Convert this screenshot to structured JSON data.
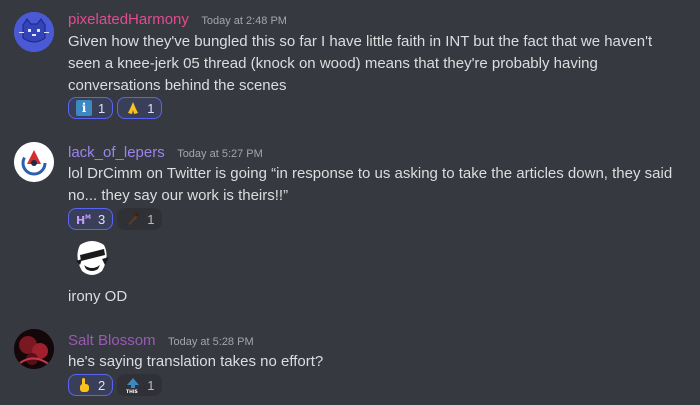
{
  "messages": [
    {
      "username": "pixelatedHarmony",
      "username_color": "#e14d8f",
      "timestamp": "Today at 2:48 PM",
      "text": "Given how they've bungled this so far I have little faith in INT but the fact that we haven't seen a knee-jerk 05 thread (knock on wood) means that they're probably having conversations behind the scenes",
      "reactions": [
        {
          "emoji": "information-emoji",
          "glyph": "i",
          "count": "1",
          "me": true
        },
        {
          "emoji": "folded-hands-emoji",
          "glyph": "🙏",
          "count": "1",
          "me": true
        }
      ]
    },
    {
      "username": "lack_of_lepers",
      "username_color": "#9b84ee",
      "timestamp": "Today at 5:27 PM",
      "text": "lol DrCimm on Twitter is going “in response to us asking to take the articles down, they said no... they say our work is theirs!!”",
      "reactions": [
        {
          "emoji": "custom-hm-emoji",
          "glyph": "Hᴹ",
          "count": "3",
          "me": true
        },
        {
          "emoji": "custom-sword-emoji",
          "glyph": "",
          "count": "1",
          "me": false
        }
      ],
      "followup_text": "irony OD"
    },
    {
      "username": "Salt Blossom",
      "username_color": "#9b59b6",
      "timestamp": "Today at 5:28 PM",
      "text": "he's saying translation takes no effort?",
      "reactions": [
        {
          "emoji": "point-up-emoji",
          "glyph": "👆",
          "count": "2",
          "me": true
        },
        {
          "emoji": "up-this-emoji",
          "glyph": "THIS",
          "count": "1",
          "me": false
        }
      ]
    }
  ]
}
